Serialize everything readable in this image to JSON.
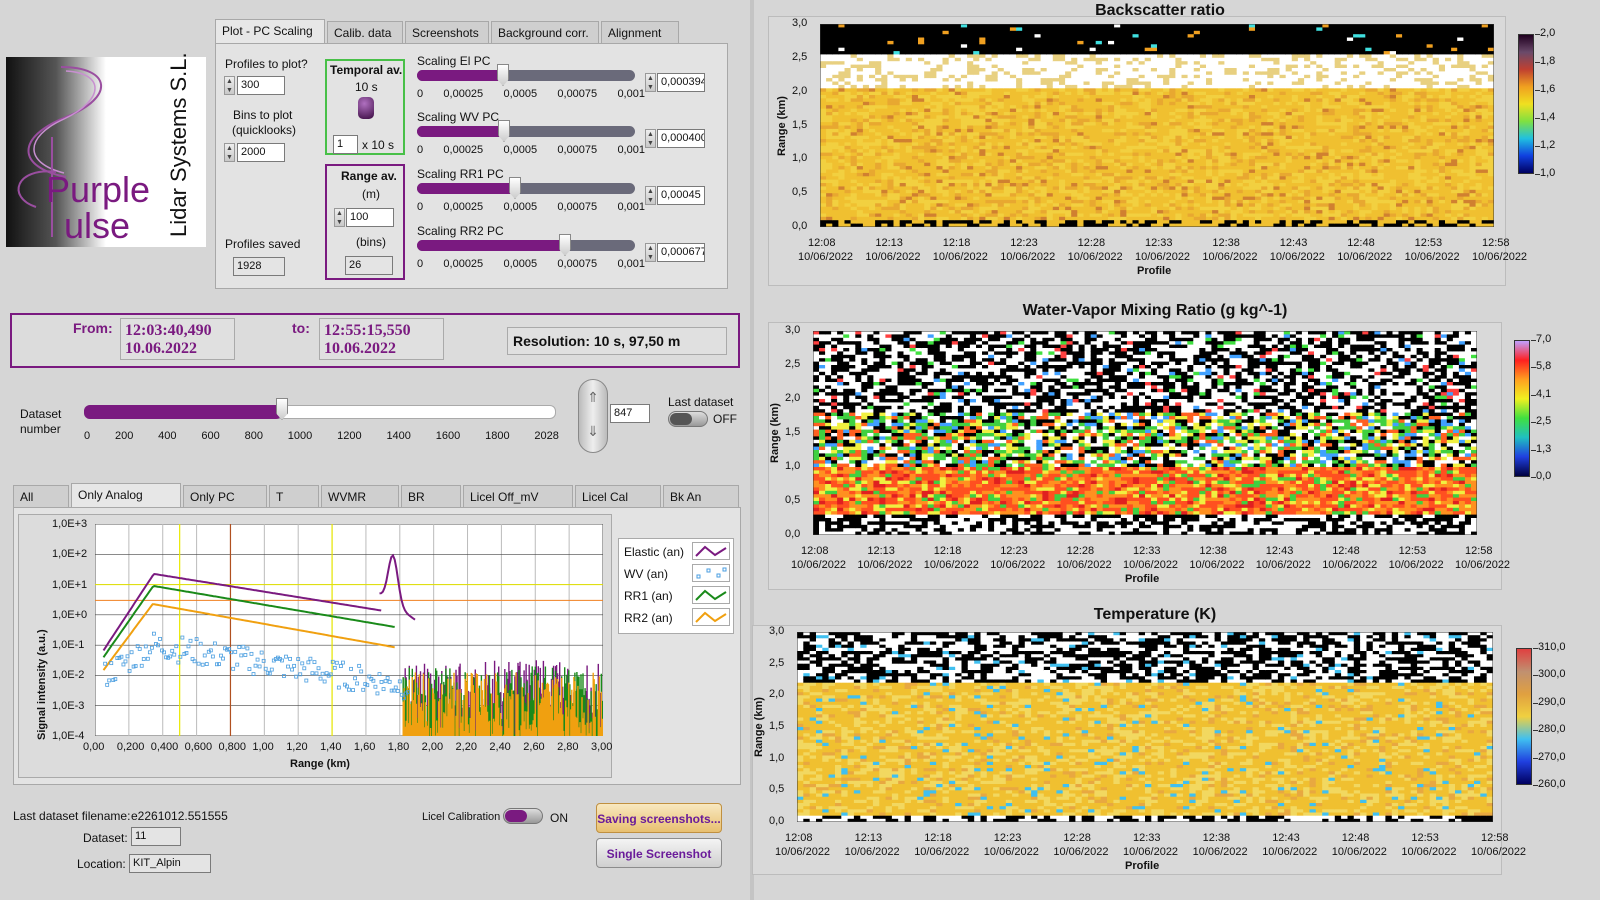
{
  "brand": {
    "logo_script": "Purple",
    "logo_script2": "ulse",
    "company": "Lidar Systems S.L."
  },
  "tabs_top": [
    "Plot - PC Scaling",
    "Calib. data",
    "Screenshots",
    "Background corr.",
    "Alignment"
  ],
  "controls": {
    "profiles_label": "Profiles to plot?",
    "profiles_value": "300",
    "bins_label1": "Bins to plot",
    "bins_label2": "(quicklooks)",
    "bins_value": "2000",
    "profiles_saved_label": "Profiles saved",
    "profiles_saved_value": "1928",
    "temporal_title": "Temporal av.",
    "temporal_sub": "10 s",
    "temporal_value": "1",
    "temporal_unit": "x 10 s",
    "range_title": "Range av.",
    "range_unit_m": "(m)",
    "range_value_m": "100",
    "range_unit_bins": "(bins)",
    "range_value_bins": "26"
  },
  "scalings": [
    {
      "label": "Scaling El PC",
      "value": "0,000394",
      "pos": 0.394
    },
    {
      "label": "Scaling WV PC",
      "value": "0,000400",
      "pos": 0.4
    },
    {
      "label": "Scaling RR1 PC",
      "value": "0,00045",
      "pos": 0.45
    },
    {
      "label": "Scaling RR2 PC",
      "value": "0,000677",
      "pos": 0.677
    }
  ],
  "scaling_ticks": [
    "0",
    "0,00025",
    "0,0005",
    "0,00075",
    "0,001"
  ],
  "time": {
    "from_label": "From:",
    "from_time": "12:03:40,490",
    "from_date": "10.06.2022",
    "to_label": "to:",
    "to_time": "12:55:15,550",
    "to_date": "10.06.2022",
    "resolution": "Resolution: 10 s, 97,50 m"
  },
  "dataset": {
    "label1": "Dataset",
    "label2": "number",
    "value": "847",
    "fraction": 0.4187,
    "ticks": [
      "0",
      "200",
      "400",
      "600",
      "800",
      "1000",
      "1200",
      "1400",
      "1600",
      "1800",
      "2028"
    ],
    "last_label": "Last dataset",
    "last_state": "OFF"
  },
  "tabs_bottom": [
    "All",
    "Only Analog",
    "Only PC",
    "T",
    "WVMR",
    "BR",
    "Licel Off_mV",
    "Licel Cal",
    "Bk An"
  ],
  "signal_plot": {
    "ylabel": "Signal intensity (a.u.)",
    "xlabel": "Range (km)",
    "yticks": [
      "1,0E+3",
      "1,0E+2",
      "1,0E+1",
      "1,0E+0",
      "1,0E-1",
      "1,0E-2",
      "1,0E-3",
      "1,0E-4"
    ],
    "xticks": [
      "0,00",
      "0,200",
      "0,400",
      "0,600",
      "0,800",
      "1,00",
      "1,20",
      "1,40",
      "1,60",
      "1,80",
      "2,00",
      "2,20",
      "2,40",
      "2,60",
      "2,80",
      "3,00"
    ],
    "legend": [
      {
        "name": "Elastic (an)",
        "color": "#7a1a80"
      },
      {
        "name": "WV (an)",
        "color": "#4a9ee0"
      },
      {
        "name": "RR1 (an)",
        "color": "#1a8a1a"
      },
      {
        "name": "RR2 (an)",
        "color": "#f0a010"
      }
    ]
  },
  "footer": {
    "file_label": "Last dataset filename:",
    "file_value": "e2261012.551555",
    "dataset_label": "Dataset:",
    "dataset_value": "11",
    "location_label": "Location:",
    "location_value": "KIT_Alpin",
    "licel_label": "Licel Calibration",
    "licel_state": "ON",
    "save_btn": "Saving screenshots...",
    "single_btn": "Single Screenshot"
  },
  "quicklooks": [
    {
      "title": "Backscatter ratio",
      "ylabel": "Range (km)",
      "xlabel": "Profile",
      "cbar": [
        "2,0",
        "1,8",
        "1,6",
        "1,4",
        "1,2",
        "1,0"
      ]
    },
    {
      "title": "Water-Vapor Mixing Ratio  (g kg^-1)",
      "ylabel": "Range (km)",
      "xlabel": "Profile",
      "cbar": [
        "7,0",
        "5,8",
        "4,1",
        "2,5",
        "1,3",
        "0,0"
      ]
    },
    {
      "title": "Temperature (K)",
      "ylabel": "Range (km)",
      "xlabel": "Profile",
      "cbar": [
        "310,0",
        "300,0",
        "290,0",
        "280,0",
        "270,0",
        "260,0"
      ]
    }
  ],
  "ql_yticks": [
    "3,0",
    "2,5",
    "2,0",
    "1,5",
    "1,0",
    "0,5",
    "0,0"
  ],
  "ql_xticks_time": [
    "12:08",
    "12:13",
    "12:18",
    "12:23",
    "12:28",
    "12:33",
    "12:38",
    "12:43",
    "12:48",
    "12:53",
    "12:58"
  ],
  "ql_xticks_date": "10/06/2022",
  "colors": {
    "accent": "#7a1a80"
  }
}
